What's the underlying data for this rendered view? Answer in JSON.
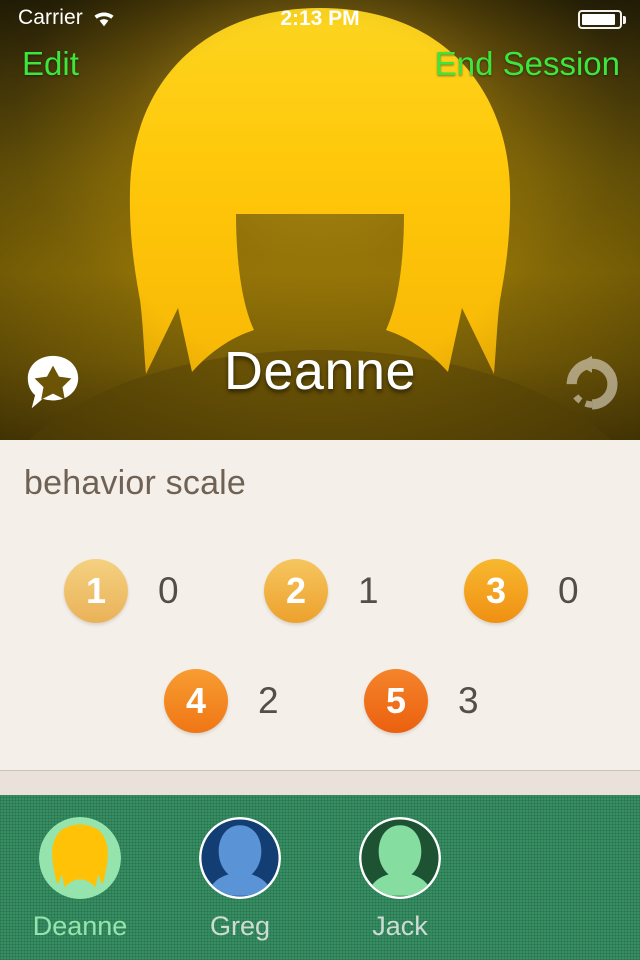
{
  "status_bar": {
    "carrier": "Carrier",
    "wifi_icon": "wifi-icon",
    "time": "2:13 PM",
    "battery_icon": "battery-icon",
    "battery_level": 92
  },
  "nav_bar": {
    "left_label": "Edit",
    "right_label": "End Session",
    "accent_color": "#3de63d"
  },
  "hero": {
    "name": "Deanne",
    "note_icon": "note-star-icon",
    "undo_icon": "undo-icon",
    "hair_color": "#ffc207",
    "background_color": "#7a6007"
  },
  "panel": {
    "title": "behavior scale",
    "background_color": "#f4efe9",
    "rows": [
      [
        {
          "level": "1",
          "count": "0",
          "color_from": "#f4d181",
          "color_to": "#eab258"
        },
        {
          "level": "2",
          "count": "1",
          "color_from": "#f6c65f",
          "color_to": "#eda12c"
        },
        {
          "level": "3",
          "count": "0",
          "color_from": "#f7b82f",
          "color_to": "#f09012"
        }
      ],
      [
        {
          "level": "4",
          "count": "2",
          "color_from": "#f79d31",
          "color_to": "#f07615"
        },
        {
          "level": "5",
          "count": "3",
          "color_from": "#f4842b",
          "color_to": "#ec600f"
        }
      ]
    ]
  },
  "tab_bar": {
    "background_color": "#2a8457",
    "selected_index": 0,
    "tabs": [
      {
        "label": "Deanne",
        "avatar_icon": "avatar-deanne",
        "selected": true,
        "ring_color": "#95e4ae",
        "bg_color": "#95e4ae",
        "hair_color": "#ffc207",
        "label_color": "#95e4ae"
      },
      {
        "label": "Greg",
        "avatar_icon": "avatar-greg",
        "selected": false,
        "ring_color": "#ffffff",
        "bg_color": "#123e74",
        "hair_color": "#5a93d6",
        "label_color": "#cddbd2"
      },
      {
        "label": "Jack",
        "avatar_icon": "avatar-jack",
        "selected": false,
        "ring_color": "#ffffff",
        "bg_color": "#1d5332",
        "hair_color": "#85dda0",
        "label_color": "#cddbd2"
      }
    ]
  }
}
